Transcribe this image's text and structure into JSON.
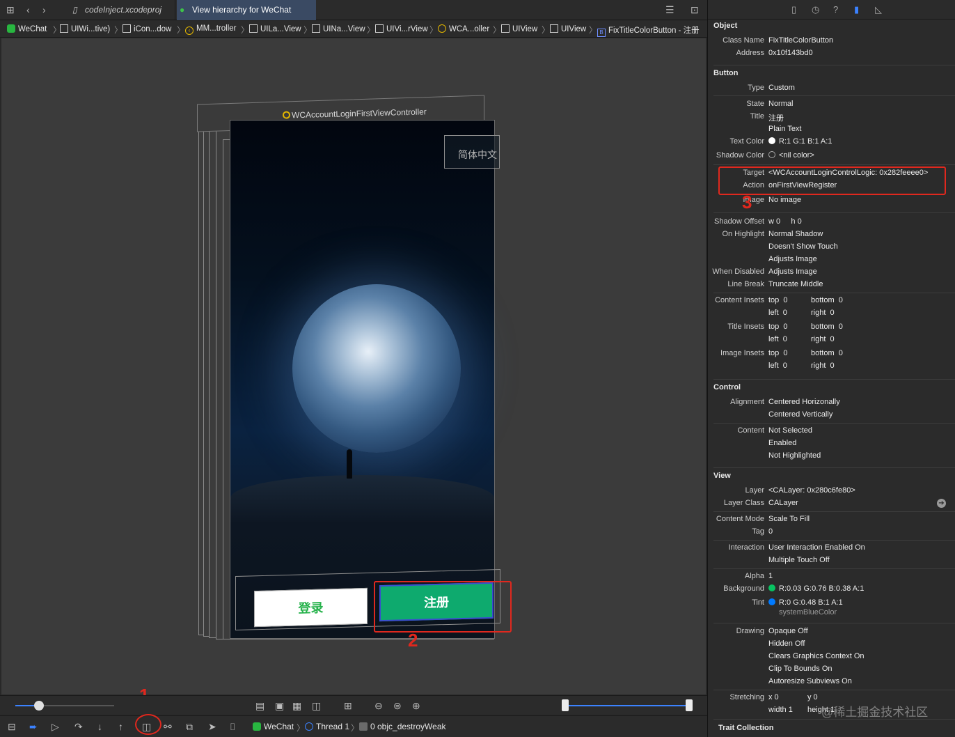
{
  "tabs": [
    {
      "label": "codeInject.xcodeproj"
    },
    {
      "label": "View hierarchy for WeChat"
    }
  ],
  "breadcrumbs": [
    "WeChat",
    "UIWi...tive)",
    "iCon...dow",
    "MM...troller",
    "UILa...View",
    "UINa...View",
    "UIVi...rView",
    "WCA...oller",
    "UIView",
    "UIView",
    "FixTitleColorButton - 注册"
  ],
  "canvas": {
    "vc_label": "WCAccountLoginFirstViewController",
    "lang_text": "简体中文",
    "login_button": "登录",
    "register_button": "注册"
  },
  "annotations": {
    "a1": "1",
    "a2": "2",
    "a3": "3"
  },
  "debugbar": {
    "app": "WeChat",
    "thread": "Thread 1",
    "frame": "0 objc_destroyWeak"
  },
  "inspector": {
    "object": {
      "title": "Object",
      "class_name_label": "Class Name",
      "class_name": "FixTitleColorButton",
      "address_label": "Address",
      "address": "0x10f143bd0"
    },
    "button": {
      "title": "Button",
      "type_label": "Type",
      "type": "Custom",
      "state_label": "State",
      "state": "Normal",
      "title_label": "Title",
      "title_value": "注册",
      "title_kind": "Plain Text",
      "text_color_label": "Text Color",
      "text_color": "R:1 G:1 B:1 A:1",
      "shadow_color_label": "Shadow Color",
      "shadow_color": "<nil color>",
      "target_label": "Target",
      "target": "<WCAccountLoginControlLogic: 0x282feeee0>",
      "action_label": "Action",
      "action": "onFirstViewRegister",
      "image_label": "Image",
      "image": "No image",
      "shadow_offset_label": "Shadow Offset",
      "shadow_offset": "w 0     h 0",
      "on_highlight_label": "On Highlight",
      "on_highlight": [
        "Normal Shadow",
        "Doesn't Show Touch",
        "Adjusts Image"
      ],
      "when_disabled_label": "When Disabled",
      "when_disabled": "Adjusts Image",
      "line_break_label": "Line Break",
      "line_break": "Truncate Middle",
      "content_insets_label": "Content Insets",
      "title_insets_label": "Title Insets",
      "image_insets_label": "Image Insets",
      "inset_top": "top  0",
      "inset_bottom": "bottom  0",
      "inset_left": "left  0",
      "inset_right": "right  0"
    },
    "control": {
      "title": "Control",
      "alignment_label": "Alignment",
      "alignment": [
        "Centered Horizonally",
        "Centered Vertically"
      ],
      "content_label": "Content",
      "content": [
        "Not Selected",
        "Enabled",
        "Not Highlighted"
      ]
    },
    "view": {
      "title": "View",
      "layer_label": "Layer",
      "layer": "<CALayer: 0x280c6fe80>",
      "layer_class_label": "Layer Class",
      "layer_class": "CALayer",
      "content_mode_label": "Content Mode",
      "content_mode": "Scale To Fill",
      "tag_label": "Tag",
      "tag": "0",
      "interaction_label": "Interaction",
      "interaction": [
        "User Interaction Enabled On",
        "Multiple Touch Off"
      ],
      "alpha_label": "Alpha",
      "alpha": "1",
      "background_label": "Background",
      "background": "R:0.03 G:0.76 B:0.38 A:1",
      "tint_label": "Tint",
      "tint": "R:0 G:0.48 B:1 A:1",
      "tint_name": "systemBlueColor",
      "drawing_label": "Drawing",
      "drawing": [
        "Opaque Off",
        "Hidden Off",
        "Clears Graphics Context On",
        "Clip To Bounds On",
        "Autoresize Subviews On"
      ],
      "stretching_label": "Stretching",
      "stretch_x": "x 0",
      "stretch_y": "y 0",
      "stretch_w": "width 1",
      "stretch_h": "height 1"
    },
    "trait": {
      "title": "Trait Collection"
    }
  },
  "watermark": "@稀土掘金技术社区",
  "colors": {
    "accent": "#3b82ff",
    "highlight": "#e0281e",
    "register_green": "#0eaa6e",
    "bg_swatch": "#08c261",
    "tint_swatch": "#007aff"
  }
}
